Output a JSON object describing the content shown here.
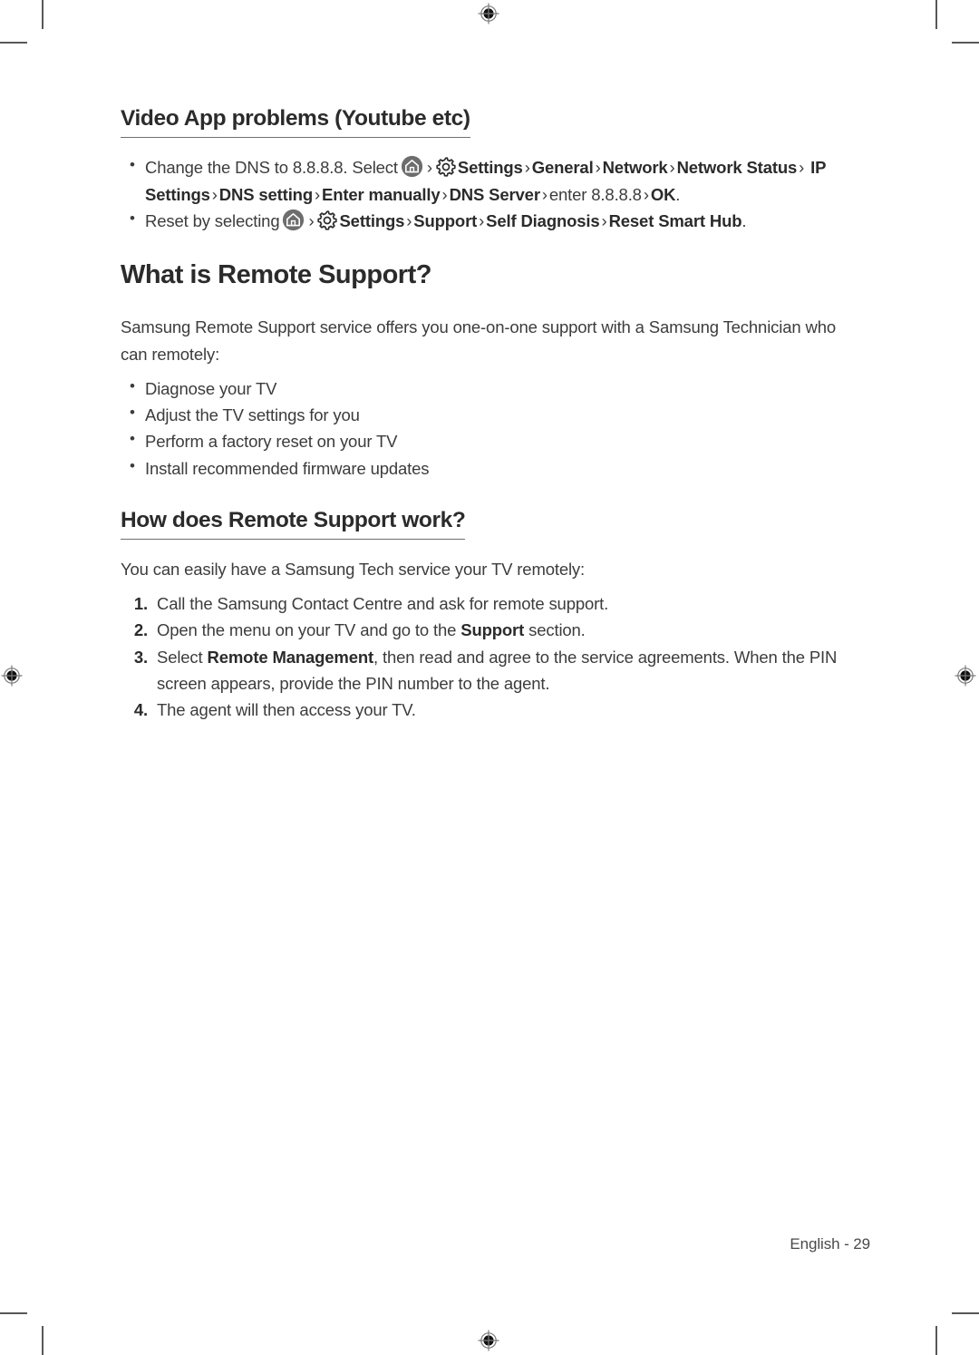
{
  "page": {
    "footer_text": "English - 29",
    "text_color": "#3c3c3c",
    "heading_color": "#2b2b2b",
    "mark_color": "#58585b"
  },
  "section_video": {
    "heading": "Video App problems (Youtube etc)",
    "bullet1": {
      "lead": "Change the DNS to 8.8.8.8. Select",
      "home_icon": "home-icon",
      "gear_icon": "gear-icon",
      "chevron": "›",
      "path": [
        "Settings",
        "General",
        "Network",
        "Network Status",
        "IP Settings",
        "DNS setting",
        "Enter manually",
        "DNS Server"
      ],
      "enter_value": "enter 8.8.8.8",
      "confirm": "OK",
      "trailing_period": "."
    },
    "bullet2": {
      "lead": "Reset by selecting",
      "home_icon": "home-icon",
      "gear_icon": "gear-icon",
      "chevron": "›",
      "path": [
        "Settings",
        "Support",
        "Self Diagnosis",
        "Reset Smart Hub"
      ],
      "trailing_period": "."
    }
  },
  "section_what": {
    "heading": "What is Remote Support?",
    "intro": "Samsung Remote Support service offers you one-on-one support with a Samsung Technician who can remotely:",
    "bullets": [
      "Diagnose your TV",
      "Adjust the TV settings for you",
      "Perform a factory reset on your TV",
      "Install recommended firmware updates"
    ]
  },
  "section_how": {
    "heading": "How does Remote Support work?",
    "intro": "You can easily have a Samsung Tech service your TV remotely:",
    "steps": [
      {
        "number": "1.",
        "text_before": "Call the Samsung Contact Centre and ask for remote support.",
        "bold": "",
        "text_after": ""
      },
      {
        "number": "2.",
        "text_before": "Open the menu on your TV and go to the ",
        "bold": "Support",
        "text_after": " section."
      },
      {
        "number": "3.",
        "text_before": "Select ",
        "bold": "Remote Management",
        "text_after": ", then read and agree to the service agreements. When the PIN screen appears, provide the PIN number to the agent."
      },
      {
        "number": "4.",
        "text_before": "The agent will then access your TV.",
        "bold": "",
        "text_after": ""
      }
    ]
  }
}
